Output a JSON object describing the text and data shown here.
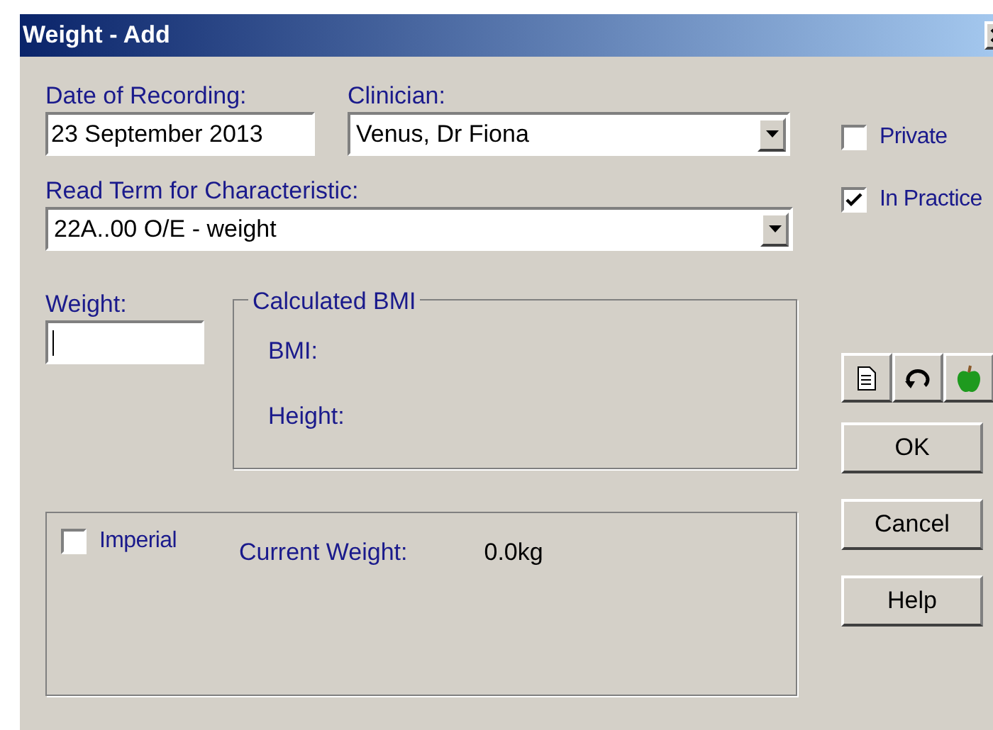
{
  "window": {
    "title": "Weight - Add"
  },
  "date_of_recording": {
    "label": "Date of Recording:",
    "value": "23 September 2013"
  },
  "clinician": {
    "label": "Clinician:",
    "value": "Venus, Dr Fiona"
  },
  "checkboxes": [
    {
      "label": "Private",
      "checked": false
    },
    {
      "label": "In Practice",
      "checked": true
    }
  ],
  "read_term": {
    "label": "Read Term for Characteristic:",
    "value": "22A..00 O/E - weight"
  },
  "weight": {
    "label": "Weight:"
  },
  "calculated_bmi": {
    "title": "Calculated BMI",
    "fields": [
      "BMI:",
      "Height:"
    ]
  },
  "imperial": {
    "label": "Imperial",
    "checked": false
  },
  "current_weight": {
    "label": "Current Weight:",
    "value": "0.0kg"
  },
  "buttons": [
    "OK",
    "Cancel",
    "Help"
  ]
}
